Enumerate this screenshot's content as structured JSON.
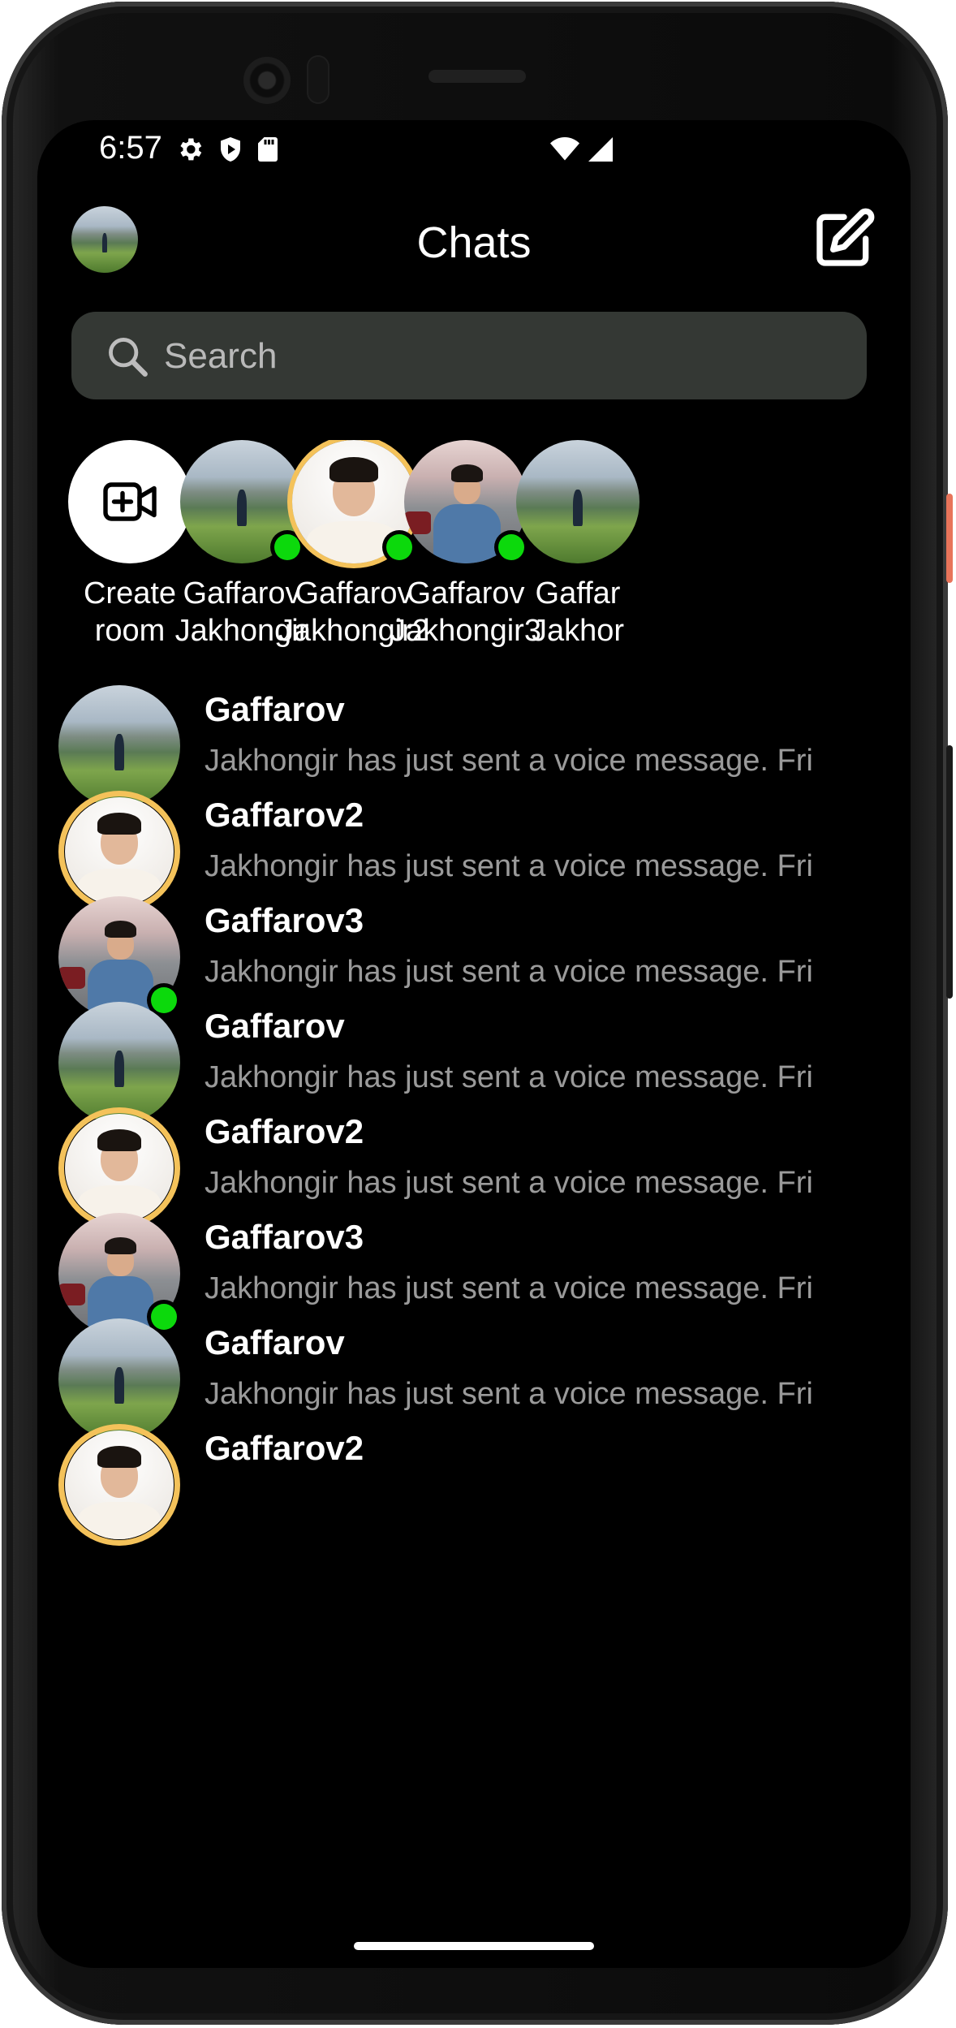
{
  "status_bar": {
    "time": "6:57",
    "icons": [
      "settings-icon",
      "shield-play-icon",
      "sd-card-icon",
      "wifi-icon",
      "signal-icon"
    ]
  },
  "header": {
    "title": "Chats",
    "compose_icon": "edit-square-icon"
  },
  "search": {
    "placeholder": "Search",
    "icon": "search-icon"
  },
  "stories": [
    {
      "label_line1": "Create",
      "label_line2": "room",
      "type": "create",
      "icon": "video-plus-icon"
    },
    {
      "label_line1": "Gaffarov",
      "label_line2": "Jakhongir",
      "online": true,
      "ring": false,
      "picture": "landscape"
    },
    {
      "label_line1": "Gaffarov",
      "label_line2": "Jakhongir2",
      "online": true,
      "ring": true,
      "picture": "portrait"
    },
    {
      "label_line1": "Gaffarov",
      "label_line2": "Jakhongir3",
      "online": true,
      "ring": false,
      "picture": "street"
    },
    {
      "label_line1": "Gaffar",
      "label_line2": "Jakhor",
      "online": false,
      "ring": false,
      "picture": "landscape"
    }
  ],
  "chats": [
    {
      "name": "Gaffarov",
      "message": "Jakhongir has just sent a voice message. Fri",
      "picture": "landscape",
      "ring": false,
      "online": false
    },
    {
      "name": "Gaffarov2",
      "message": "Jakhongir has just sent a voice message. Fri",
      "picture": "portrait",
      "ring": true,
      "online": false
    },
    {
      "name": "Gaffarov3",
      "message": "Jakhongir has just sent a voice message. Fri",
      "picture": "street",
      "ring": false,
      "online": true
    },
    {
      "name": "Gaffarov",
      "message": "Jakhongir has just sent a voice message. Fri",
      "picture": "landscape",
      "ring": false,
      "online": false
    },
    {
      "name": "Gaffarov2",
      "message": "Jakhongir has just sent a voice message. Fri",
      "picture": "portrait",
      "ring": true,
      "online": false
    },
    {
      "name": "Gaffarov3",
      "message": "Jakhongir has just sent a voice message. Fri",
      "picture": "street",
      "ring": false,
      "online": true
    },
    {
      "name": "Gaffarov",
      "message": "Jakhongir has just sent a voice message. Fri",
      "picture": "landscape",
      "ring": false,
      "online": false
    },
    {
      "name": "Gaffarov2",
      "message": "",
      "picture": "portrait",
      "ring": true,
      "online": false
    }
  ],
  "colors": {
    "background": "#000000",
    "search_bg": "#343834",
    "online": "#0cd90c",
    "story_ring": "#f4c25a",
    "secondary_text": "#9a9a9a"
  }
}
